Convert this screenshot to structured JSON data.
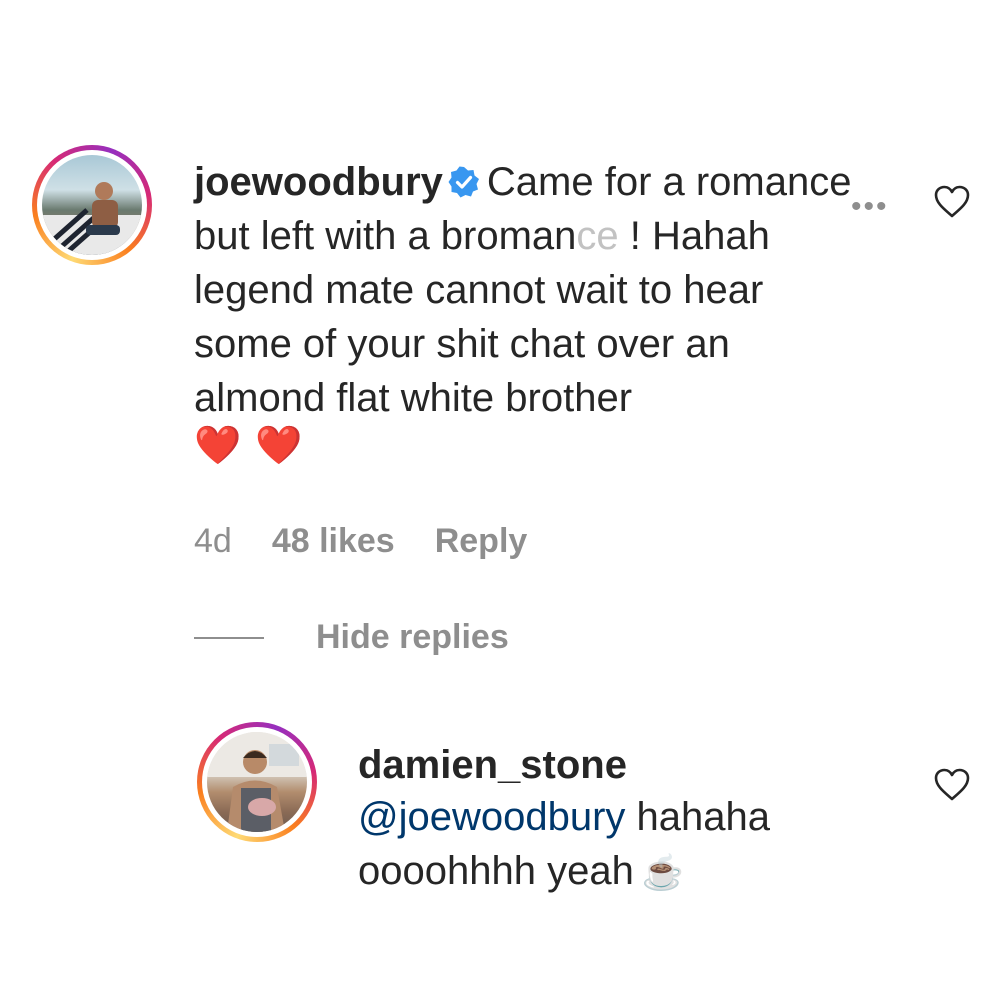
{
  "comment": {
    "username": "joewoodbury",
    "text_main": "Came for a romance but left with a broman",
    "text_faded": "ce",
    "text_rest": "! Hahah legend mate cannot wait to hear some of your shit chat over an almond flat white brother",
    "emoji": [
      "❤️",
      "❤️"
    ],
    "age": "4d",
    "likes": "48 likes",
    "reply_label": "Reply",
    "more_label": "•••"
  },
  "replies_toggle": {
    "label": "Hide replies"
  },
  "reply": {
    "username": "damien_stone",
    "mention": "@joewoodbury",
    "text": "hahaha oooohhhh yeah",
    "emoji": "☕"
  },
  "colors": {
    "text": "#262626",
    "secondary": "#8e8e8e",
    "mention": "#00376b",
    "verified": "#3897f0"
  },
  "icons": [
    "verified-badge-icon",
    "more-options-icon",
    "heart-outline-icon",
    "red-heart-emoji",
    "coffee-emoji"
  ]
}
